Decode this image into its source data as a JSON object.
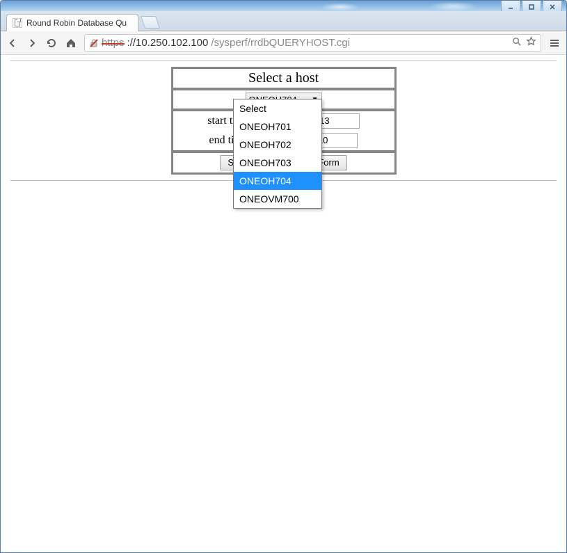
{
  "window": {
    "tab_title": "Round Robin Database Qu"
  },
  "address_bar": {
    "scheme": "https",
    "host": "://10.250.102.100",
    "path": "/sysperf/rrdbQUERYHOST.cgi"
  },
  "form": {
    "title": "Select a host",
    "host_select": {
      "selected": "ONEOH704",
      "options": [
        "Select",
        "ONEOH701",
        "ONEOH702",
        "ONEOH703",
        "ONEOH704",
        "ONEOVM700"
      ]
    },
    "start_label": "start time:",
    "start_value": "02/04/2015-10:13",
    "end_label": "end time:",
    "end_value": "02/04/2015-16:10",
    "submit_label": "Submit",
    "reset_label": "Reset Form"
  }
}
